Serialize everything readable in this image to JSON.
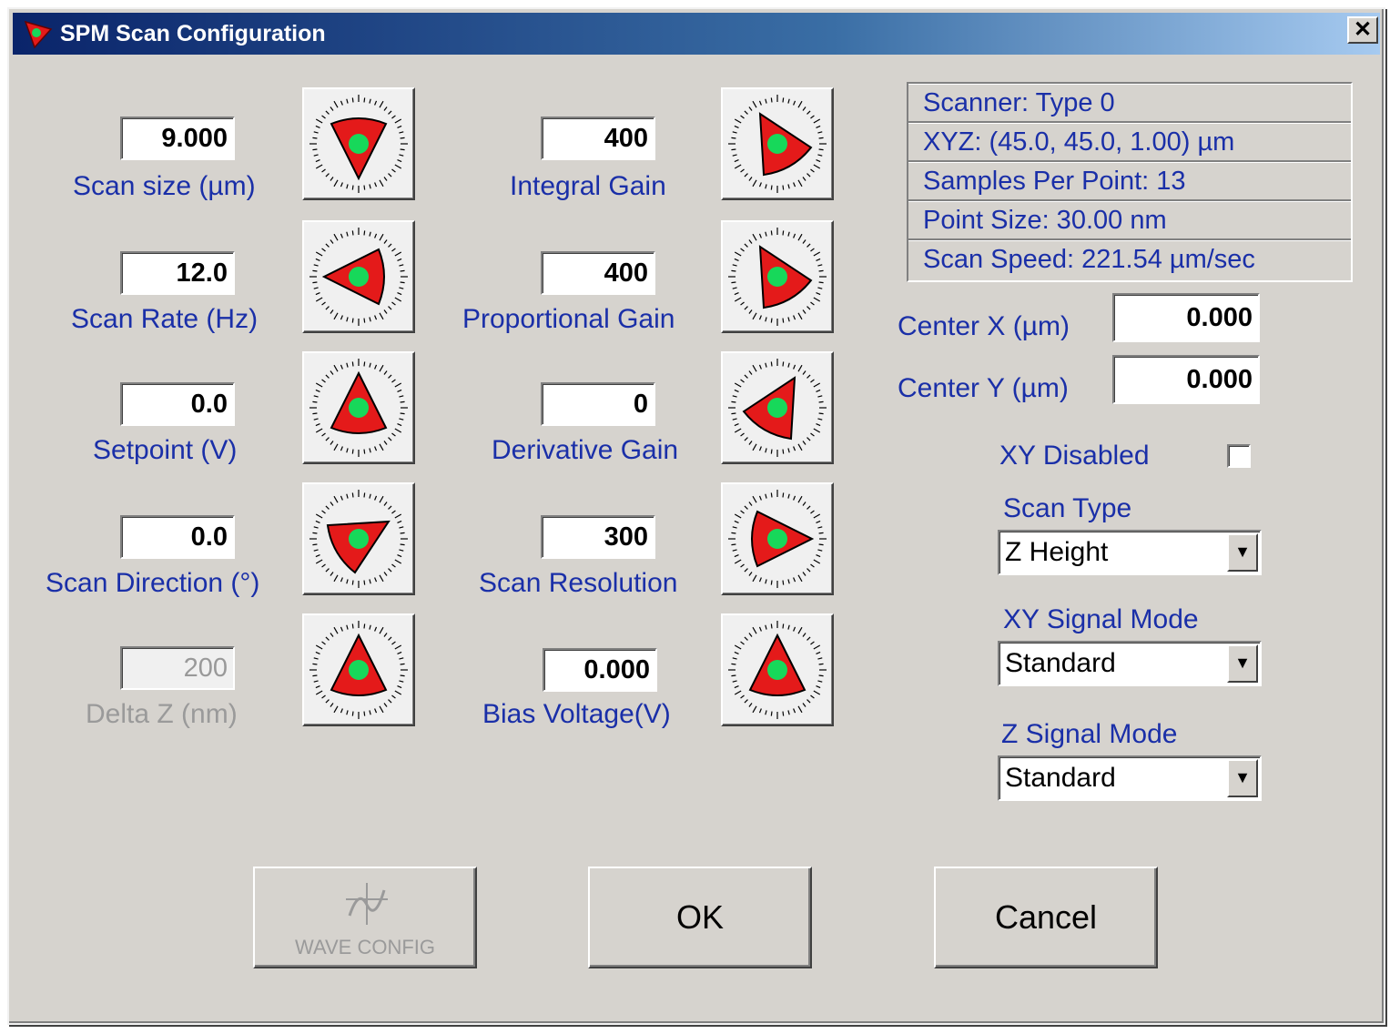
{
  "window": {
    "title": "SPM Scan Configuration",
    "close_glyph": "✕"
  },
  "params_left": [
    {
      "label": "Scan size (µm)",
      "value": "9.000",
      "disabled": false,
      "knob_angle": 180
    },
    {
      "label": "Scan Rate (Hz)",
      "value": "12.0",
      "disabled": false,
      "knob_angle": -90
    },
    {
      "label": "Setpoint (V)",
      "value": "0.0",
      "disabled": false,
      "knob_angle": 0
    },
    {
      "label": "Scan Direction (°)",
      "value": "0.0",
      "disabled": false,
      "knob_angle": 60
    },
    {
      "label": "Delta Z (nm)",
      "value": "200",
      "disabled": true,
      "knob_angle": 0
    }
  ],
  "params_middle": [
    {
      "label": "Integral Gain",
      "value": "400",
      "disabled": false,
      "knob_angle": -30
    },
    {
      "label": "Proportional Gain",
      "value": "400",
      "disabled": false,
      "knob_angle": -30
    },
    {
      "label": "Derivative Gain",
      "value": "0",
      "disabled": false,
      "knob_angle": 30
    },
    {
      "label": "Scan Resolution",
      "value": "300",
      "disabled": false,
      "knob_angle": 90
    },
    {
      "label": "Bias Voltage(V)",
      "value": "0.000",
      "disabled": false,
      "knob_angle": 0
    }
  ],
  "info": {
    "scanner": "Scanner:  Type 0",
    "xyz": "XYZ:  (45.0, 45.0, 1.00) µm",
    "samples": "Samples Per Point:  13",
    "point_size": "Point Size:  30.00 nm",
    "scan_speed": "Scan Speed:  221.54 µm/sec"
  },
  "center_x": {
    "label": "Center X (µm)",
    "value": "0.000"
  },
  "center_y": {
    "label": "Center Y (µm)",
    "value": "0.000"
  },
  "xy_disabled": {
    "label": "XY Disabled",
    "checked": false
  },
  "scan_type": {
    "label": "Scan Type",
    "value": "Z Height"
  },
  "xy_signal_mode": {
    "label": "XY Signal Mode",
    "value": "Standard"
  },
  "z_signal_mode": {
    "label": "Z Signal Mode",
    "value": "Standard"
  },
  "buttons": {
    "wave_config": "WAVE CONFIG",
    "ok": "OK",
    "cancel": "Cancel"
  },
  "colors": {
    "label_blue": "#1a2fa8",
    "knob_red": "#e41a1a",
    "knob_green": "#17d85a"
  }
}
